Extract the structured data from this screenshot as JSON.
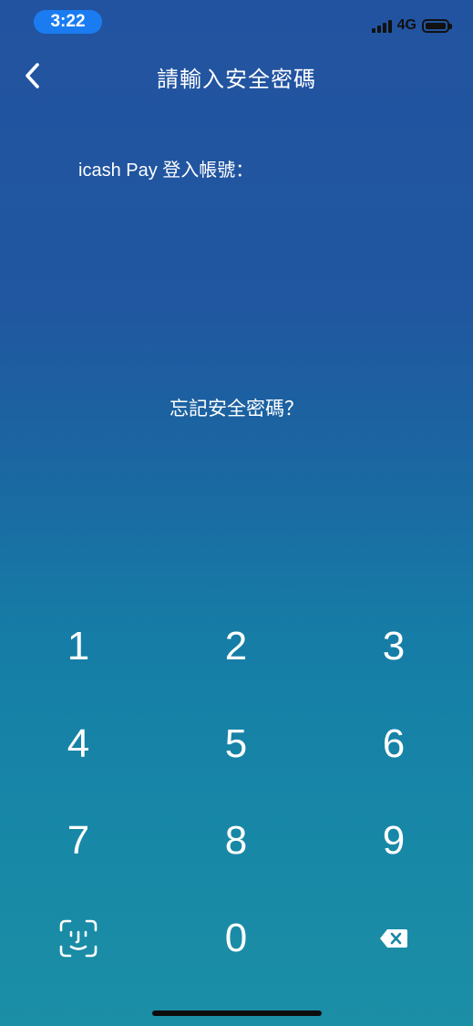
{
  "status_bar": {
    "time": "3:22",
    "network": "4G",
    "icons": [
      "signal-icon",
      "battery-icon"
    ]
  },
  "header": {
    "back_icon": "chevron-left-icon",
    "title": "請輸入安全密碼"
  },
  "account": {
    "label": "icash Pay 登入帳號："
  },
  "forgot_password": "忘記安全密碼？",
  "keypad": {
    "keys": [
      "1",
      "2",
      "3",
      "4",
      "5",
      "6",
      "7",
      "8",
      "9",
      "0"
    ],
    "face_id_icon": "face-id-icon",
    "delete_icon": "backspace-icon"
  },
  "colors": {
    "background_top": "#2253a0",
    "background_bottom": "#1b8fa6",
    "time_pill": "#1a7cf0",
    "text": "#ffffff"
  }
}
